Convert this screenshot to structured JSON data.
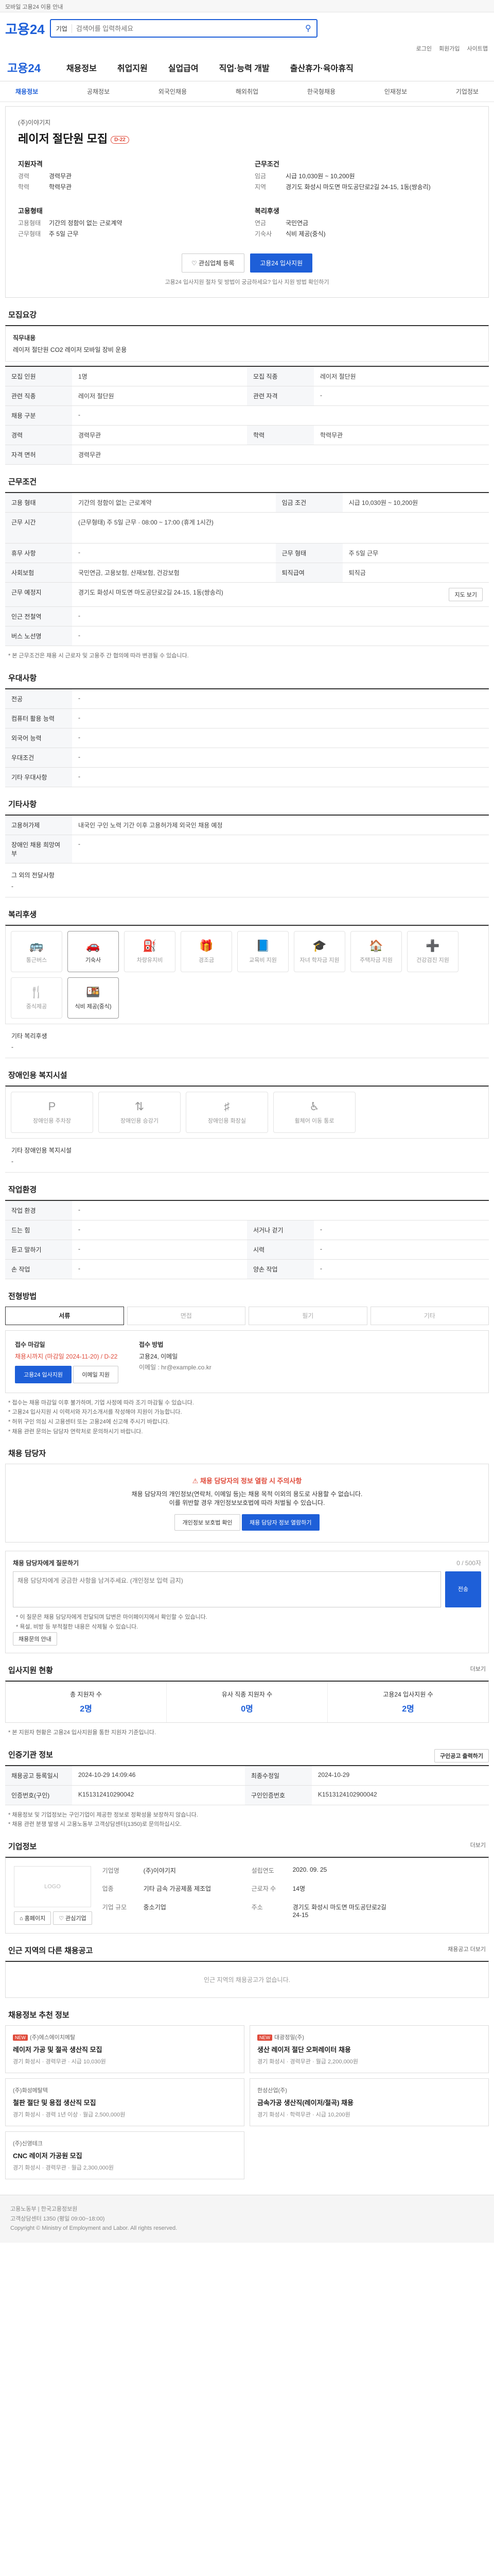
{
  "topbar": {
    "text": "모바일 고용24 이용 안내"
  },
  "search": {
    "placeholder": "검색어를 입력하세요",
    "type_label": "기업"
  },
  "util": [
    "로그인",
    "회원가입",
    "사이트맵"
  ],
  "gnb": {
    "brand": "고용24",
    "items": [
      "채용정보",
      "취업지원",
      "실업급여",
      "직업·능력 개발",
      "출산휴가·육아휴직"
    ]
  },
  "lnb": [
    "채용정보",
    "공채정보",
    "외국인채용",
    "해외취업",
    "한국형채용",
    "인재정보",
    "기업정보"
  ],
  "summary": {
    "corp": "(주)이야기지",
    "title": "레이저 절단원 모집",
    "badge": "D-22",
    "left_heading": "지원자격",
    "left": [
      {
        "k": "경력",
        "v": "경력무관"
      },
      {
        "k": "학력",
        "v": "학력무관"
      }
    ],
    "right_heading": "근무조건",
    "right": [
      {
        "k": "임금",
        "v": "시급 10,030원 ~ 10,200원"
      },
      {
        "k": "지역",
        "v": "경기도 화성시 마도면 마도공단로2길 24-15, 1동(쌍송리)"
      }
    ],
    "left2_heading": "고용형태",
    "left2": [
      {
        "k": "고용형태",
        "v": "기간의 정함이 없는 근로계약"
      },
      {
        "k": "근무형태",
        "v": "주 5일 근무"
      }
    ],
    "right2_heading": "복리후생",
    "right2": [
      {
        "k": "연금",
        "v": "국민연금"
      },
      {
        "k": "기숙사",
        "v": "식비 제공(중식)"
      }
    ],
    "btn_scrap": "관심업체 등록",
    "btn_apply": "고용24 입사지원",
    "note": "고용24 입사지원 절차 및 방법이 궁금하세요? 입사 지원 방법 확인하기"
  },
  "recruit": {
    "title": "모집요강",
    "job_summary_label": "직무내용",
    "job_summary": "레이저 절단원 CO2 레이저 모바일 장비 운용",
    "rows": [
      {
        "k": "모집 인원",
        "v": "1명",
        "k2": "모집 직종",
        "v2": "레이저 절단원"
      },
      {
        "k": "관련 직종",
        "v": "레이저 절단원",
        "k2": "관련 자격",
        "v2": "-"
      },
      {
        "k": "채용 구분",
        "v": "-",
        "k2": "",
        "v2": ""
      },
      {
        "k": "경력",
        "v": "경력무관",
        "k2": "학력",
        "v2": "학력무관"
      },
      {
        "k": "자격 면허",
        "v": "경력무관",
        "k2": "",
        "v2": ""
      }
    ]
  },
  "work": {
    "title": "근무조건",
    "rows": [
      {
        "k": "고용 형태",
        "v": "기간의 정함이 없는 근로계약",
        "k2": "임금 조건",
        "v2": "시급 10,030원 ~ 10,200원"
      },
      {
        "k": "근무 시간",
        "v": "(근무형태) 주 5일 근무 · 08:00 ~ 17:00 (휴게 1시간)",
        "k2": "",
        "v2": ""
      },
      {
        "k": "휴무 사항",
        "v": "-",
        "k2": "근무 형태",
        "v2": "주 5일 근무"
      },
      {
        "k": "사회보험",
        "v": "국민연금, 고용보험, 산재보험, 건강보험",
        "k2": "퇴직급여",
        "v2": "퇴직금"
      },
      {
        "k": "근무 예정지",
        "v": "경기도 화성시 마도면 마도공단로2길 24-15, 1동(쌍송리)",
        "k2": "",
        "v2": ""
      },
      {
        "k": "인근 전철역",
        "v": "-",
        "k2": "",
        "v2": ""
      },
      {
        "k": "버스 노선명",
        "v": "-",
        "k2": "",
        "v2": ""
      }
    ],
    "map_button": "지도 보기",
    "note": "* 본 근무조건은 채용 시 근로자 및 고용주 간 협의에 따라 변경될 수 있습니다."
  },
  "etc": {
    "title": "우대사항",
    "rows": [
      {
        "k": "전공",
        "v": "-"
      },
      {
        "k": "컴퓨터 활용 능력",
        "v": "-"
      },
      {
        "k": "외국어 능력",
        "v": "-"
      },
      {
        "k": "우대조건",
        "v": "-"
      },
      {
        "k": "기타 우대사항",
        "v": "-"
      }
    ]
  },
  "other": {
    "title": "기타사항",
    "rows": [
      {
        "k": "고용허가제",
        "v": "내국인 구인 노력 기간 이후 고용허가제 외국인 채용 예정"
      },
      {
        "k": "장애인 채용 희망여부",
        "v": "-"
      }
    ],
    "sub_label": "그 외의 전달사항",
    "sub_value": "-"
  },
  "welfare": {
    "title": "복리후생",
    "items": [
      {
        "label": "통근버스",
        "icon": "bus-icon",
        "glyph": "🚌",
        "on": false
      },
      {
        "label": "기숙사",
        "icon": "car-icon",
        "glyph": "🚗",
        "on": true
      },
      {
        "label": "차량유지비",
        "icon": "fuel-icon",
        "glyph": "⛽",
        "on": false
      },
      {
        "label": "경조금",
        "icon": "gift-icon",
        "glyph": "🎁",
        "on": false
      },
      {
        "label": "교육비 지원",
        "icon": "book-icon",
        "glyph": "📘",
        "on": false
      },
      {
        "label": "자녀 학자금 지원",
        "icon": "cap-icon",
        "glyph": "🎓",
        "on": false
      },
      {
        "label": "주택자금 지원",
        "icon": "house-icon",
        "glyph": "🏠",
        "on": false
      },
      {
        "label": "건강검진 지원",
        "icon": "health-icon",
        "glyph": "➕",
        "on": false
      },
      {
        "label": "중식제공",
        "icon": "meal-icon",
        "glyph": "🍴",
        "on": false
      },
      {
        "label": "식비 제공(중식)",
        "icon": "food-icon",
        "glyph": "🍱",
        "on": true
      }
    ],
    "extra_label": "기타 복리후생",
    "extra_value": "-"
  },
  "disabled": {
    "title": "장애인용 복지시설",
    "items": [
      "장애인용 주차장",
      "장애인용 승강기",
      "장애인용 화장실",
      "휠체어 이동 통로"
    ],
    "extra_label": "기타 장애인용 복지시설",
    "extra_value": "-"
  },
  "env": {
    "title": "작업환경",
    "rows": [
      {
        "k": "작업 환경",
        "v": "-",
        "k2": "",
        "v2": ""
      },
      {
        "k": "드는 힘",
        "v": "-",
        "k2": "서거나 걷기",
        "v2": "-"
      },
      {
        "k": "듣고 말하기",
        "v": "-",
        "k2": "시력",
        "v2": "-"
      },
      {
        "k": "손 작업",
        "v": "-",
        "k2": "양손 작업",
        "v2": "-"
      }
    ]
  },
  "method": {
    "title": "전형방법",
    "steps": [
      "서류",
      "면접",
      "필기",
      "기타"
    ],
    "apply_heading": "접수 마감일",
    "deadline": "채용시까지 (마감일 2024-11-20) / D-22",
    "apply_btn": "고용24 입사지원",
    "email_btn": "이메일 지원",
    "process_heading": "접수 방법",
    "process_value": "고용24, 이메일",
    "process_sub": "이메일 : hr@example.co.kr",
    "bullets": [
      "* 접수는 채용 마감일 이후 불가하며, 기업 사정에 따라 조기 마감될 수 있습니다.",
      "* 고용24 입사지원 시 이력서와 자기소개서를 작성해야 지원이 가능합니다.",
      "* 허위 구인 의심 시 고용센터 또는 고용24에 신고해 주시기 바랍니다.",
      "* 채용 관련 문의는 담당자 연락처로 문의하시기 바랍니다."
    ]
  },
  "contact": {
    "title": "채용 담당자",
    "warn_title": "채용 담당자의 정보 열람 시 주의사항",
    "warn_text": "채용 담당자의 개인정보(연락처, 이메일 등)는 채용 목적 이외의 용도로 사용할 수 없습니다.",
    "warn_text2": "이를 위반할 경우 개인정보보호법에 따라 처벌될 수 있습니다.",
    "btn_agree": "개인정보 보호법 확인",
    "btn_view": "채용 담당자 정보 열람하기"
  },
  "inquiry": {
    "title": "채용 담당자에게 질문하기",
    "counter": "0 / 500자",
    "placeholder": "채용 담당자에게 궁금한 사항을 남겨주세요. (개인정보 입력 금지)",
    "send": "전송",
    "bullets": [
      "* 이 질문은 채용 담당자에게 전달되며 답변은 마이페이지에서 확인할 수 있습니다.",
      "* 욕설, 비방 등 부적절한 내용은 삭제될 수 있습니다."
    ],
    "notice_btn": "채용문의 안내"
  },
  "stats": {
    "title": "입사지원 현황",
    "more": "더보기",
    "items": [
      {
        "label": "총 지원자 수",
        "value": "2명"
      },
      {
        "label": "유사 직종 지원자 수",
        "value": "0명"
      },
      {
        "label": "고용24 입사지원 수",
        "value": "2명"
      }
    ],
    "note": "* 본 지원자 현황은 고용24 입사지원을 통한 지원자 기준입니다."
  },
  "info": {
    "title": "인증기관 정보",
    "print_btn": "구인공고 출력하기",
    "rows": [
      {
        "k": "채용공고 등록일시",
        "v": "2024-10-29 14:09:46",
        "k2": "최종수정일",
        "v2": "2024-10-29"
      },
      {
        "k": "인증번호(구인)",
        "v": "K151312410290042",
        "k2": "구인인증번호",
        "v2": "K1513124102900042"
      }
    ],
    "bullets": [
      "* 채용정보 및 기업정보는 구인기업이 제공한 정보로 정확성을 보장하지 않습니다.",
      "* 채용 관련 분쟁 발생 시 고용노동부 고객상담센터(1350)로 문의하십시오."
    ]
  },
  "company": {
    "title": "기업정보",
    "more": "더보기",
    "logo": "LOGO",
    "btn_site": "홈페이지",
    "btn_fav": "관심기업",
    "fields": [
      {
        "k": "기업명",
        "v": "(주)이야기지"
      },
      {
        "k": "설립연도",
        "v": "2020. 09. 25"
      },
      {
        "k": "업종",
        "v": "기타 금속 가공제품 제조업"
      },
      {
        "k": "근로자 수",
        "v": "14명"
      },
      {
        "k": "기업 규모",
        "v": "중소기업"
      },
      {
        "k": "주소",
        "v": "경기도 화성시 마도면 마도공단로2길 24-15"
      }
    ]
  },
  "similar": {
    "title": "인근 지역의 다른 채용공고",
    "more": "채용공고 더보기",
    "empty": "인근 지역의 채용공고가 없습니다."
  },
  "recommend": {
    "title": "채용정보 추천 정보",
    "cards": [
      {
        "corp": "(주)에스에이치메탈",
        "title": "레이저 가공 및 절곡 생산직 모집",
        "meta": "경기 화성시 · 경력무관 · 시급 10,030원",
        "new": true
      },
      {
        "corp": "대광정밀(주)",
        "title": "생산 레이저 절단 오퍼레이터 채용",
        "meta": "경기 화성시 · 경력무관 · 월급 2,200,000원",
        "new": true
      },
      {
        "corp": "(주)화성메탈텍",
        "title": "철판 절단 및 용접 생산직 모집",
        "meta": "경기 화성시 · 경력 1년 이상 · 월급 2,500,000원",
        "new": false
      },
      {
        "corp": "한성산업(주)",
        "title": "금속가공 생산직(레이저/절곡) 채용",
        "meta": "경기 화성시 · 학력무관 · 시급 10,200원",
        "new": false
      },
      {
        "corp": "(주)신영테크",
        "title": "CNC 레이저 가공원 모집",
        "meta": "경기 화성시 · 경력무관 · 월급 2,300,000원",
        "new": false
      }
    ]
  },
  "footer": {
    "line1": "고용노동부 | 한국고용정보원",
    "line2": "고객상담센터 1350 (평일 09:00~18:00)",
    "line3": "Copyright © Ministry of Employment and Labor. All rights reserved."
  }
}
